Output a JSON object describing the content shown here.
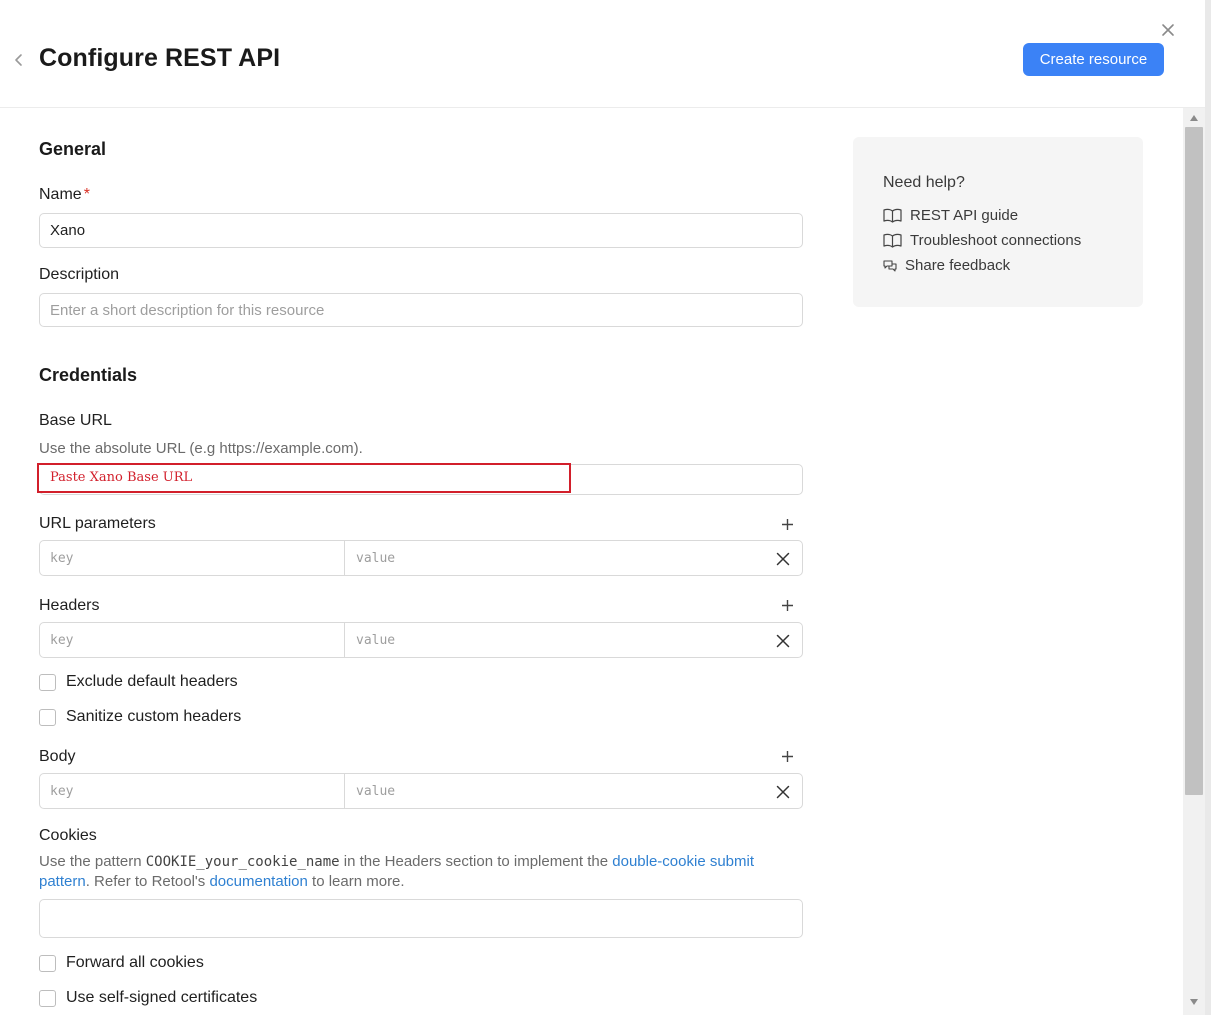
{
  "header": {
    "title": "Configure REST API",
    "create_label": "Create resource"
  },
  "general": {
    "section_title": "General",
    "name_label": "Name",
    "name_required": "*",
    "name_value": "Xano",
    "description_label": "Description",
    "description_placeholder": "Enter a short description for this resource"
  },
  "credentials": {
    "section_title": "Credentials",
    "base_url_label": "Base URL",
    "base_url_hint": "Use the absolute URL (e.g https://example.com).",
    "base_url_annotation": "Paste Xano Base URL",
    "url_params_label": "URL parameters",
    "headers_label": "Headers",
    "body_label": "Body",
    "key_placeholder": "key",
    "value_placeholder": "value",
    "exclude_default_headers": "Exclude default headers",
    "sanitize_custom_headers": "Sanitize custom headers",
    "cookies_label": "Cookies",
    "cookies_hint_1": "Use the pattern ",
    "cookies_pattern": "COOKIE_your_cookie_name",
    "cookies_hint_2": " in the Headers section to implement the ",
    "cookies_link_1": "double-cookie submit pattern",
    "cookies_hint_3": ". Refer to Retool's ",
    "cookies_link_2": "documentation",
    "cookies_hint_4": " to learn more.",
    "forward_all_cookies": "Forward all cookies",
    "self_signed_certs": "Use self-signed certificates"
  },
  "help": {
    "title": "Need help?",
    "items": [
      {
        "label": "REST API guide",
        "icon": "book-icon"
      },
      {
        "label": "Troubleshoot connections",
        "icon": "book-icon"
      },
      {
        "label": "Share feedback",
        "icon": "chat-icon"
      }
    ]
  },
  "colors": {
    "primary": "#3b82f6",
    "link": "#2f80d1",
    "required": "#d93025",
    "annotation": "#d21f2b"
  }
}
